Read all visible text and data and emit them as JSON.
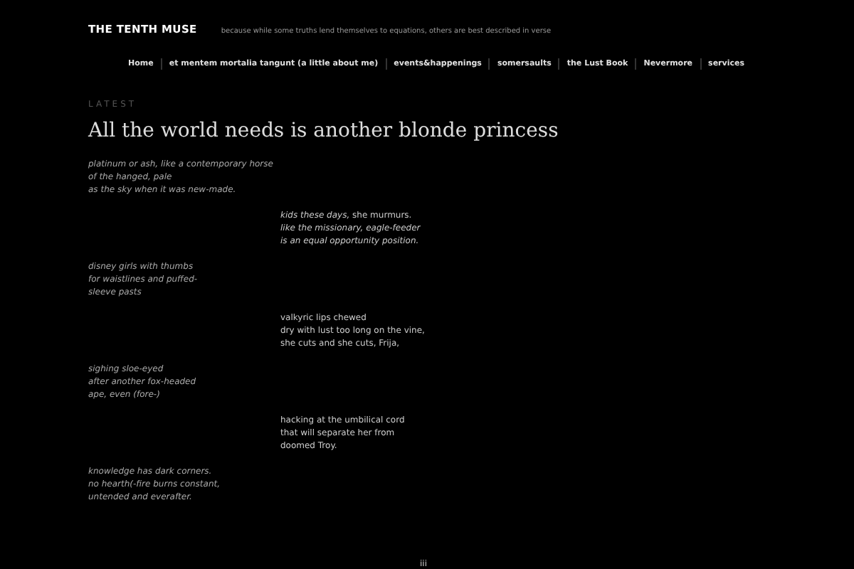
{
  "site": {
    "title": "THE TENTH MUSE",
    "tagline": "because while some truths lend themselves to equations, others are best described in verse"
  },
  "nav": [
    "Home",
    "et mentem mortalia tangunt (a little about me)",
    "events&happenings",
    "somersaults",
    "the Lust Book",
    "Nevermore",
    "services"
  ],
  "section_label": "LATEST",
  "post": {
    "title": "All the world needs is another blonde princess",
    "stanzas": [
      {
        "kind": "left",
        "lines": [
          "platinum or ash, like a contemporary horse",
          "of the hanged, pale",
          "as the sky when it was new-made."
        ]
      },
      {
        "kind": "right",
        "lines": [
          "*kids these days,* she murmurs.",
          "*like the missionary, eagle-feeder*",
          "*is an equal opportunity position.*"
        ]
      },
      {
        "kind": "left",
        "lines": [
          "disney girls with thumbs",
          "for waistlines and puffed-",
          "sleeve pasts"
        ]
      },
      {
        "kind": "right",
        "lines": [
          "valkyric lips chewed",
          "dry with lust too long on the vine,",
          "she cuts and she cuts, Frija,"
        ]
      },
      {
        "kind": "left",
        "lines": [
          "sighing sloe-eyed",
          "after another fox-headed",
          "ape, even (fore-)"
        ]
      },
      {
        "kind": "right",
        "lines": [
          "hacking at the umbilical cord",
          "that will separate her from",
          "doomed Troy."
        ]
      },
      {
        "kind": "left",
        "lines": [
          "knowledge has dark corners.",
          "no hearth(-fire burns constant,",
          "untended and everafter."
        ]
      }
    ],
    "section_mark": "iii"
  }
}
